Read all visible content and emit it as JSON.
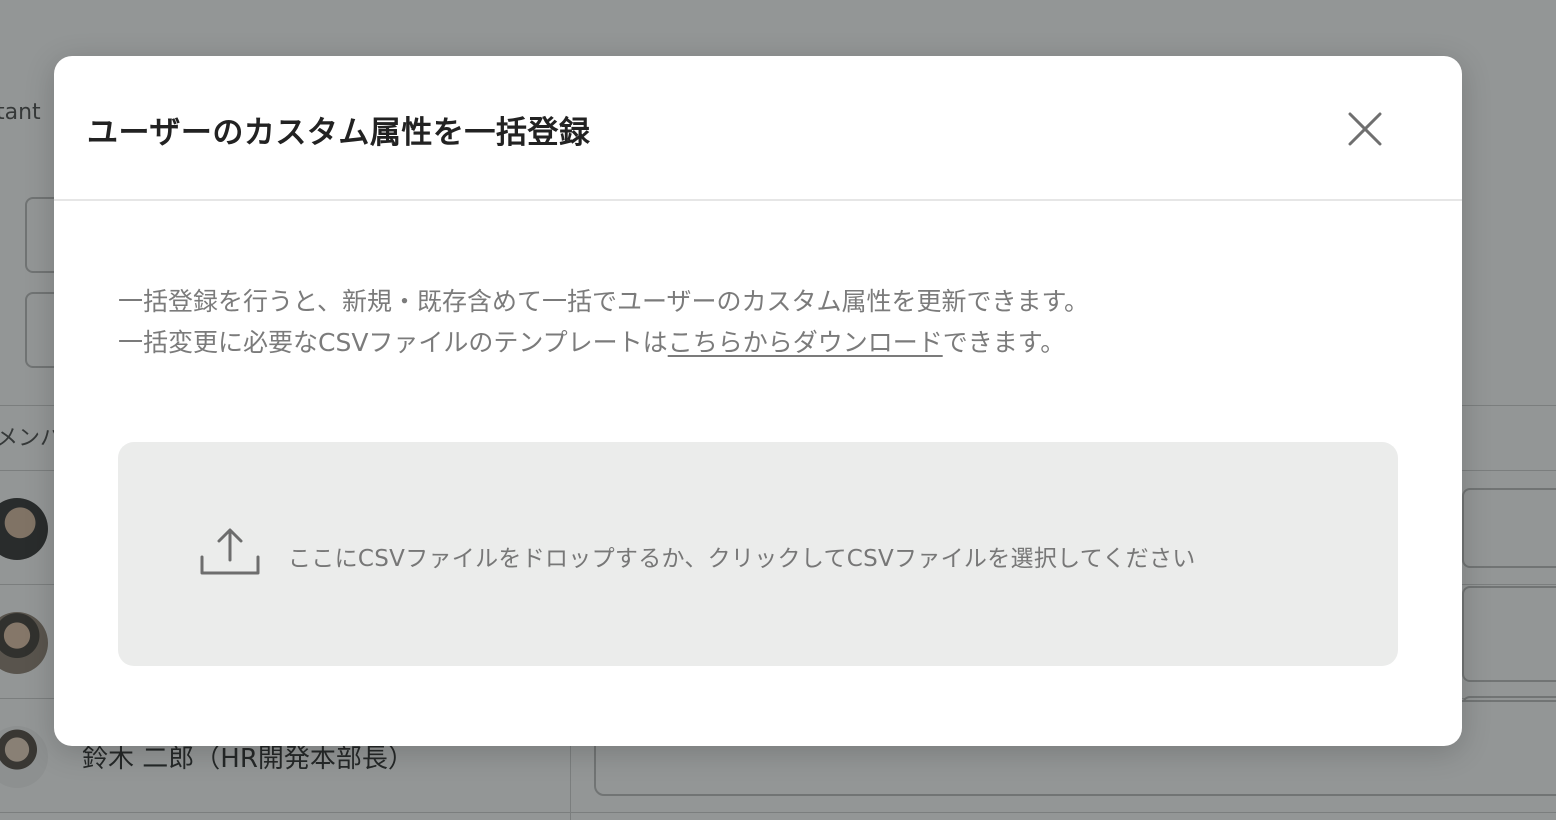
{
  "background": {
    "tenant_fragment": "tant",
    "member_header_fragment": "メンバ",
    "member_name": "鈴木 二郎（HR開発本部長）"
  },
  "modal": {
    "title": "ユーザーのカスタム属性を一括登録",
    "close_icon": "close-icon",
    "description": {
      "line1": "一括登録を行うと、新規・既存含めて一括でユーザーのカスタム属性を更新できます。",
      "line2_prefix": "一括変更に必要なCSVファイルのテンプレートは",
      "line2_link": "こちらからダウンロード",
      "line2_suffix": "できます。"
    },
    "dropzone": {
      "icon": "upload-icon",
      "text": "ここにCSVファイルをドロップするか、クリックしてCSVファイルを選択してください"
    }
  },
  "colors": {
    "overlay": "#282d2d",
    "dropzone_bg": "#ebeceb",
    "text_muted": "#7b7b7b",
    "title_text": "#222222"
  }
}
